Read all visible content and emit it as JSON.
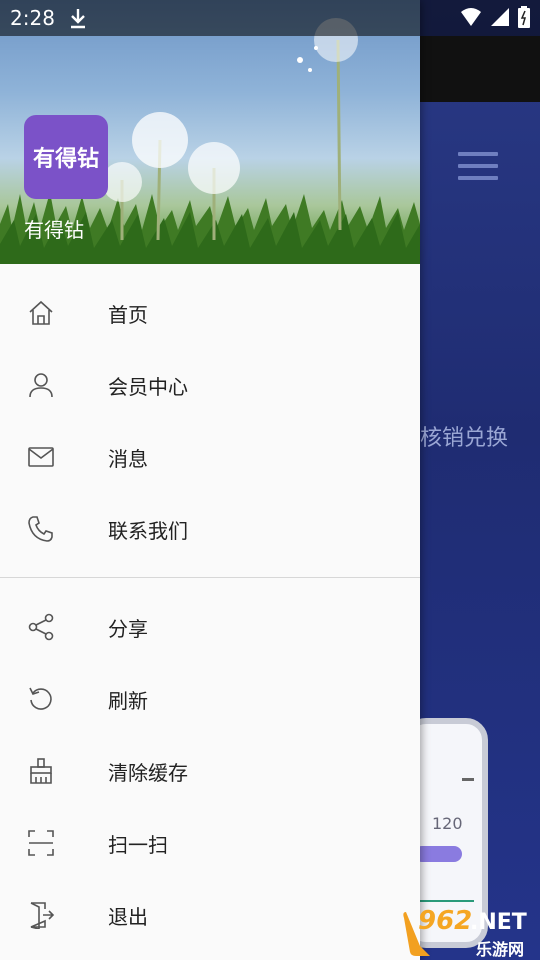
{
  "status_bar": {
    "time": "2:28"
  },
  "background": {
    "partial_text": "码核销兑换",
    "phone_value": "120"
  },
  "drawer": {
    "app_name_logo": "有得钻",
    "app_name": "有得钻",
    "menu_primary": [
      {
        "label": "首页",
        "icon": "home-icon"
      },
      {
        "label": "会员中心",
        "icon": "person-icon"
      },
      {
        "label": "消息",
        "icon": "mail-icon"
      },
      {
        "label": "联系我们",
        "icon": "phone-icon"
      }
    ],
    "menu_secondary": [
      {
        "label": "分享",
        "icon": "share-icon"
      },
      {
        "label": "刷新",
        "icon": "refresh-icon"
      },
      {
        "label": "清除缓存",
        "icon": "broom-icon"
      },
      {
        "label": "扫一扫",
        "icon": "scan-icon"
      },
      {
        "label": "退出",
        "icon": "exit-icon"
      }
    ]
  },
  "watermark": {
    "number": "962",
    "suffix": ".NET",
    "tagline": "乐游网"
  },
  "colors": {
    "drawer_bg": "#fafafa",
    "logo_bg": "#7b52c8",
    "icon_stroke": "#555555"
  }
}
